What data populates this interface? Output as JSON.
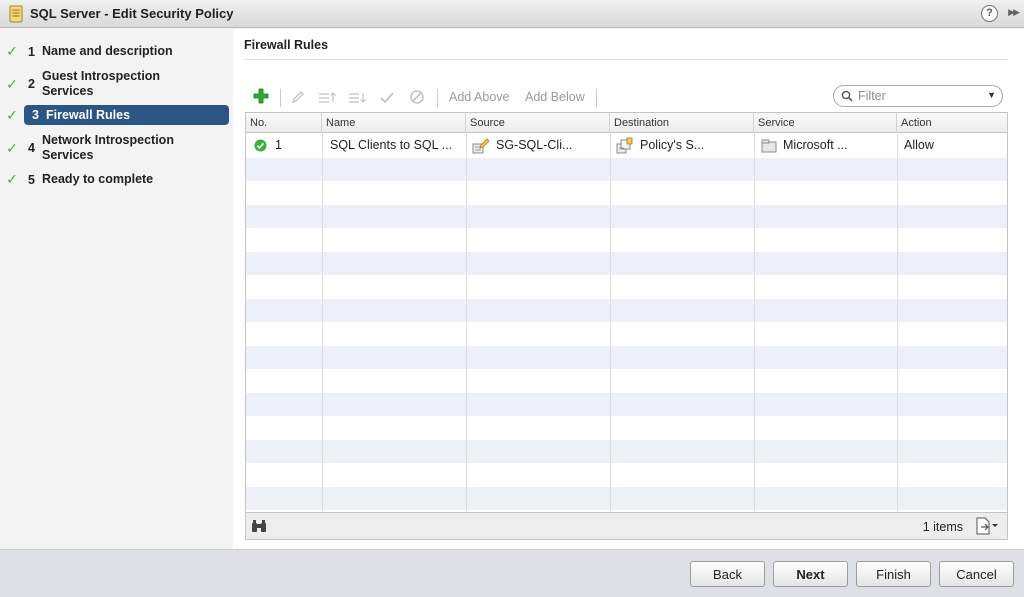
{
  "window": {
    "title": "SQL Server - Edit Security Policy",
    "help_label": "?",
    "expand_label": "▶▶"
  },
  "steps": [
    {
      "num": "1",
      "label": "Name and description",
      "done": true
    },
    {
      "num": "2",
      "label": "Guest Introspection Services",
      "done": true
    },
    {
      "num": "3",
      "label": "Firewall Rules",
      "done": true,
      "active": true
    },
    {
      "num": "4",
      "label": "Network Introspection Services",
      "done": true
    },
    {
      "num": "5",
      "label": "Ready to complete",
      "done": true
    }
  ],
  "main": {
    "section_title": "Firewall Rules",
    "toolbar": {
      "add_above": "Add Above",
      "add_below": "Add Below"
    },
    "filter": {
      "placeholder": "Filter"
    },
    "columns": [
      "No.",
      "Name",
      "Source",
      "Destination",
      "Service",
      "Action"
    ],
    "rows": [
      {
        "no": "1",
        "name": "SQL Clients to SQL ...",
        "source": "SG-SQL-Cli...",
        "destination": "Policy's S...",
        "service": "Microsoft ...",
        "action": "Allow"
      }
    ],
    "footer": {
      "items_count": "1 items"
    }
  },
  "buttons": {
    "back": "Back",
    "next": "Next",
    "finish": "Finish",
    "cancel": "Cancel"
  },
  "colors": {
    "active_step": "#2a5585",
    "check": "#3fae3a",
    "add_icon": "#2eaa2e",
    "row_alt": "#edf1f7"
  }
}
